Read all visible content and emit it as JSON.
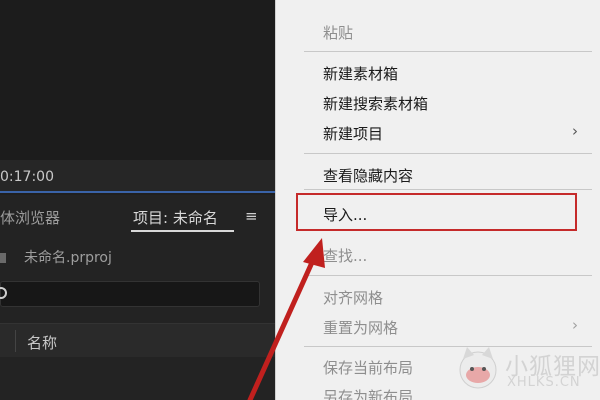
{
  "monitor": {
    "timecode": "0:17:00"
  },
  "panel": {
    "tabs": [
      {
        "label": "体浏览器"
      },
      {
        "label": "项目: 未命名"
      }
    ],
    "tab_menu_icon": "hamburger-icon",
    "file_name": "未命名.prproj",
    "search_icon": "search-icon",
    "column_name": "名称"
  },
  "context_menu": {
    "items": [
      {
        "label": "粘贴",
        "disabled": true
      },
      {
        "label": "新建素材箱",
        "disabled": false
      },
      {
        "label": "新建搜索素材箱",
        "disabled": false
      },
      {
        "label": "新建项目",
        "disabled": false,
        "submenu": true
      },
      {
        "label": "查看隐藏内容",
        "disabled": false
      },
      {
        "label": "导入...",
        "disabled": false,
        "highlighted": true
      },
      {
        "label": "查找...",
        "disabled": true
      },
      {
        "label": "对齐网格",
        "disabled": true
      },
      {
        "label": "重置为网格",
        "disabled": true,
        "submenu": true
      },
      {
        "label": "保存当前布局",
        "disabled": true
      },
      {
        "label": "另存为新布局",
        "disabled": true
      }
    ],
    "submenu_icon": "chevron-right-icon",
    "highlight_color": "#c52a2a"
  },
  "annotation": {
    "arrow_color": "#c0201e"
  },
  "watermark": {
    "text": "小狐狸网",
    "subtext": "XHLKS.CN"
  }
}
